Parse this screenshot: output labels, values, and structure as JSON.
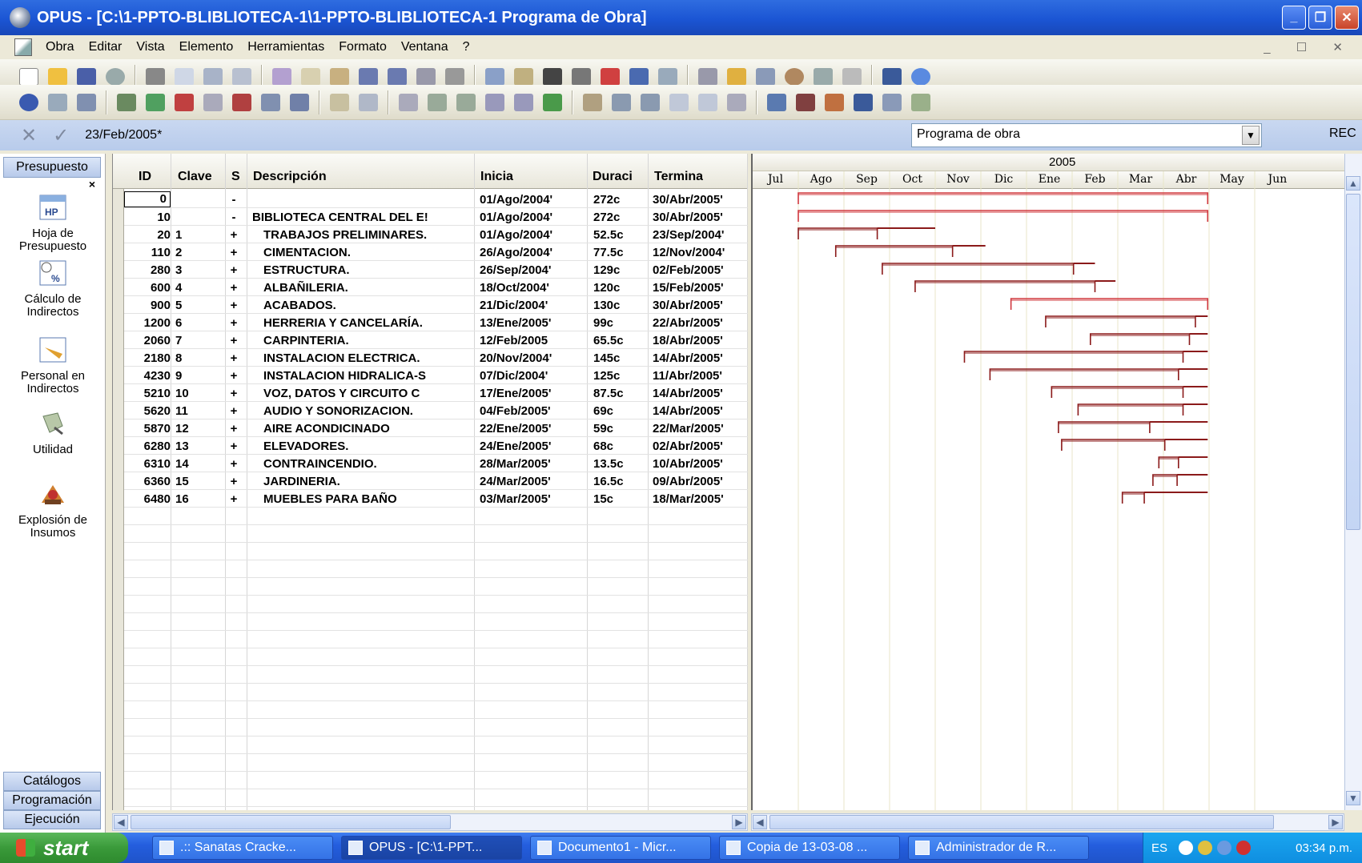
{
  "window": {
    "title": "OPUS - [C:\\1-PPTO-BLIBLIOTECA-1\\1-PPTO-BLIBLIOTECA-1 Programa de Obra]",
    "min": "_",
    "restore": "❐",
    "close": "✕"
  },
  "menu": [
    "Obra",
    "Editar",
    "Vista",
    "Elemento",
    "Herramientas",
    "Formato",
    "Ventana",
    "?"
  ],
  "mdi_controls": "_ ☐ ✕",
  "edit_row": {
    "cancel": "✕",
    "accept": "✓",
    "value": "23/Feb/2005*",
    "view_selector": "Programa de obra",
    "rec": "REC"
  },
  "left_bar": {
    "header": "Presupuesto",
    "close": "×",
    "items": [
      {
        "label": "Hoja de Presupuesto",
        "icon": "budget-sheet-icon"
      },
      {
        "label": "Cálculo de Indirectos",
        "icon": "indirect-calc-icon"
      },
      {
        "label": "Personal en Indirectos",
        "icon": "indirect-staff-icon"
      },
      {
        "label": "Utilidad",
        "icon": "utility-icon"
      },
      {
        "label": "Explosión de Insumos",
        "icon": "supplies-explosion-icon"
      }
    ],
    "tabs": [
      "Catálogos",
      "Programación",
      "Ejecución"
    ]
  },
  "grid": {
    "columns": [
      "ID",
      "Clave",
      "S",
      "Descripción",
      "Inicia",
      "Duraci",
      "Termina"
    ],
    "rows": [
      {
        "id": "0",
        "clave": "",
        "s": "-",
        "desc": "",
        "inicia": "01/Ago/2004'",
        "dur": "272c",
        "termina": "30/Abr/2005'"
      },
      {
        "id": "10",
        "clave": "",
        "s": "-",
        "desc": "BIBLIOTECA CENTRAL DEL E!",
        "inicia": "01/Ago/2004'",
        "dur": "272c",
        "termina": "30/Abr/2005'"
      },
      {
        "id": "20",
        "clave": "1",
        "s": "+",
        "desc": "TRABAJOS PRELIMINARES.",
        "inicia": "01/Ago/2004'",
        "dur": "52.5c",
        "termina": "23/Sep/2004'"
      },
      {
        "id": "110",
        "clave": "2",
        "s": "+",
        "desc": "CIMENTACION.",
        "inicia": "26/Ago/2004'",
        "dur": "77.5c",
        "termina": "12/Nov/2004'"
      },
      {
        "id": "280",
        "clave": "3",
        "s": "+",
        "desc": "ESTRUCTURA.",
        "inicia": "26/Sep/2004'",
        "dur": "129c",
        "termina": "02/Feb/2005'"
      },
      {
        "id": "600",
        "clave": "4",
        "s": "+",
        "desc": "ALBAÑILERIA.",
        "inicia": "18/Oct/2004'",
        "dur": "120c",
        "termina": "15/Feb/2005'"
      },
      {
        "id": "900",
        "clave": "5",
        "s": "+",
        "desc": "ACABADOS.",
        "inicia": "21/Dic/2004'",
        "dur": "130c",
        "termina": "30/Abr/2005'"
      },
      {
        "id": "1200",
        "clave": "6",
        "s": "+",
        "desc": "HERRERIA Y CANCELARÍA.",
        "inicia": "13/Ene/2005'",
        "dur": "99c",
        "termina": "22/Abr/2005'"
      },
      {
        "id": "2060",
        "clave": "7",
        "s": "+",
        "desc": "CARPINTERIA.",
        "inicia": "12/Feb/2005",
        "dur": "65.5c",
        "termina": "18/Abr/2005'"
      },
      {
        "id": "2180",
        "clave": "8",
        "s": "+",
        "desc": "INSTALACION ELECTRICA.",
        "inicia": "20/Nov/2004'",
        "dur": "145c",
        "termina": "14/Abr/2005'"
      },
      {
        "id": "4230",
        "clave": "9",
        "s": "+",
        "desc": "INSTALACION HIDRALICA-S",
        "inicia": "07/Dic/2004'",
        "dur": "125c",
        "termina": "11/Abr/2005'"
      },
      {
        "id": "5210",
        "clave": "10",
        "s": "+",
        "desc": "VOZ, DATOS Y CIRCUITO C",
        "inicia": "17/Ene/2005'",
        "dur": "87.5c",
        "termina": "14/Abr/2005'"
      },
      {
        "id": "5620",
        "clave": "11",
        "s": "+",
        "desc": "AUDIO Y SONORIZACION.",
        "inicia": "04/Feb/2005'",
        "dur": "69c",
        "termina": "14/Abr/2005'"
      },
      {
        "id": "5870",
        "clave": "12",
        "s": "+",
        "desc": "AIRE ACONDICINADO",
        "inicia": "22/Ene/2005'",
        "dur": "59c",
        "termina": "22/Mar/2005'"
      },
      {
        "id": "6280",
        "clave": "13",
        "s": "+",
        "desc": "ELEVADORES.",
        "inicia": "24/Ene/2005'",
        "dur": "68c",
        "termina": "02/Abr/2005'"
      },
      {
        "id": "6310",
        "clave": "14",
        "s": "+",
        "desc": "CONTRAINCENDIO.",
        "inicia": "28/Mar/2005'",
        "dur": "13.5c",
        "termina": "10/Abr/2005'"
      },
      {
        "id": "6360",
        "clave": "15",
        "s": "+",
        "desc": "JARDINERIA.",
        "inicia": "24/Mar/2005'",
        "dur": "16.5c",
        "termina": "09/Abr/2005'"
      },
      {
        "id": "6480",
        "clave": "16",
        "s": "+",
        "desc": "MUEBLES PARA BAÑO",
        "inicia": "03/Mar/2005'",
        "dur": "15c",
        "termina": "18/Mar/2005'"
      }
    ]
  },
  "gantt": {
    "year": "2005",
    "months": [
      "Jul",
      "Ago",
      "Sep",
      "Oct",
      "Nov",
      "Dic",
      "Ene",
      "Feb",
      "Mar",
      "Abr",
      "May",
      "Jun"
    ],
    "bars": [
      {
        "start": 1.0,
        "end": 9.97,
        "float_end": 9.97,
        "critical": true
      },
      {
        "start": 1.0,
        "end": 9.97,
        "float_end": 9.97,
        "critical": true
      },
      {
        "start": 1.0,
        "end": 2.73,
        "float_end": 4.0,
        "critical": false
      },
      {
        "start": 1.82,
        "end": 4.38,
        "float_end": 5.1,
        "critical": false
      },
      {
        "start": 2.84,
        "end": 7.03,
        "float_end": 7.5,
        "critical": false
      },
      {
        "start": 3.56,
        "end": 7.5,
        "float_end": 7.95,
        "critical": false
      },
      {
        "start": 5.66,
        "end": 9.97,
        "float_end": 9.97,
        "critical": true
      },
      {
        "start": 6.42,
        "end": 9.7,
        "float_end": 9.97,
        "critical": false
      },
      {
        "start": 7.4,
        "end": 9.57,
        "float_end": 9.97,
        "critical": false
      },
      {
        "start": 4.64,
        "end": 9.43,
        "float_end": 9.97,
        "critical": false
      },
      {
        "start": 5.2,
        "end": 9.33,
        "float_end": 9.97,
        "critical": false
      },
      {
        "start": 6.55,
        "end": 9.43,
        "float_end": 9.97,
        "critical": false
      },
      {
        "start": 7.13,
        "end": 9.43,
        "float_end": 9.97,
        "critical": false
      },
      {
        "start": 6.7,
        "end": 8.7,
        "float_end": 9.97,
        "critical": false
      },
      {
        "start": 6.77,
        "end": 9.03,
        "float_end": 9.97,
        "critical": false
      },
      {
        "start": 8.9,
        "end": 9.33,
        "float_end": 9.97,
        "critical": false
      },
      {
        "start": 8.77,
        "end": 9.3,
        "float_end": 9.97,
        "critical": false
      },
      {
        "start": 8.1,
        "end": 8.58,
        "float_end": 9.97,
        "critical": false
      }
    ]
  },
  "taskbar": {
    "start": "start",
    "tasks": [
      ".:: Sanatas Cracke...",
      "OPUS - [C:\\1-PPT...",
      "Documento1 - Micr...",
      "Copia de 13-03-08 ...",
      "Administrador de R..."
    ],
    "lang": "ES",
    "clock": "03:34 p.m."
  }
}
